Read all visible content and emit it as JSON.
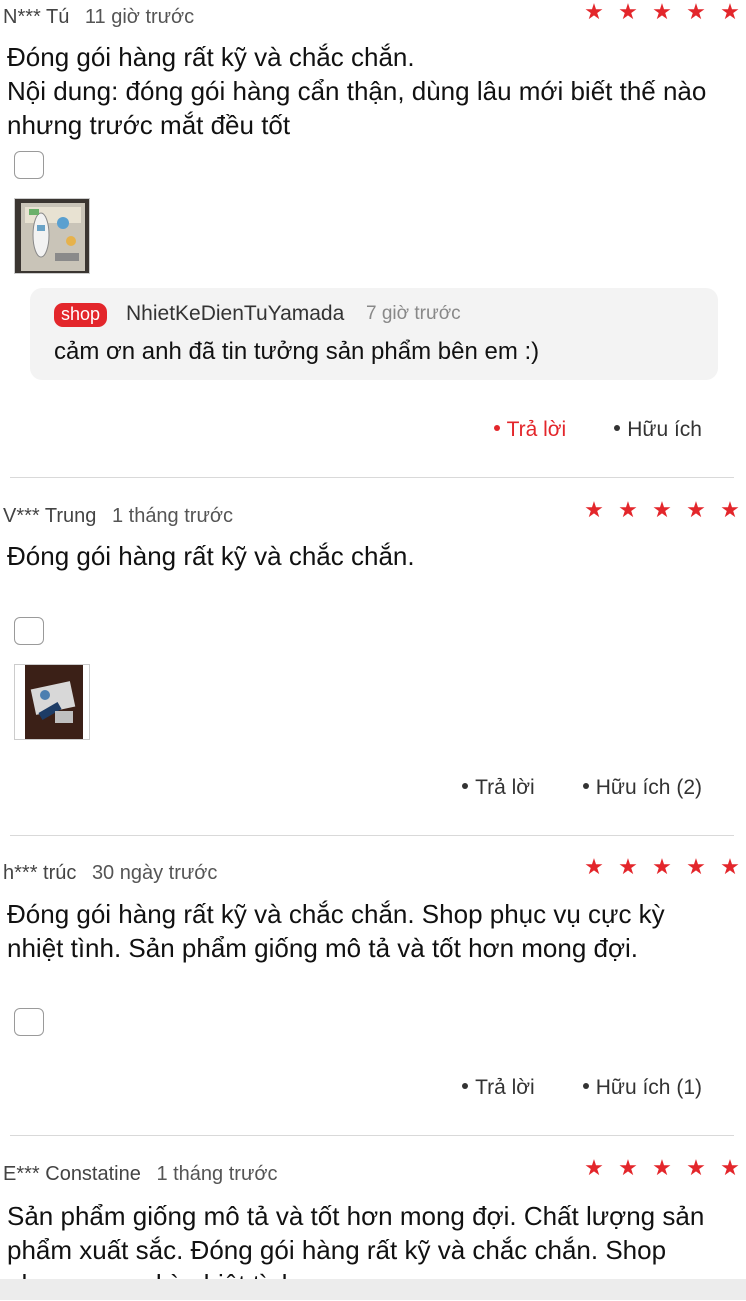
{
  "colors": {
    "accent": "#e3262b",
    "star": "#e3262b"
  },
  "reviews": [
    {
      "user": "N*** Tú",
      "time": "11 giờ trước",
      "rating": 5,
      "text_lines": [
        "Đóng gói hàng rất kỹ và chắc chắn.",
        "Nội dung: đóng gói hàng cẩn thận, dùng lâu mới biết thế nào",
        "nhưng trước mắt đều tốt"
      ],
      "shop_reply": {
        "badge": "shop",
        "name": "NhietKeDienTuYamada",
        "time": "7 giờ trước",
        "message": "cảm ơn anh đã tin tưởng sản phẩm bên em :)"
      },
      "reply_label": "Trả lời",
      "helpful_label": "Hữu ích"
    },
    {
      "user": "V*** Trung",
      "time": "1 tháng trước",
      "rating": 5,
      "text_lines": [
        "Đóng gói hàng rất kỹ và chắc chắn."
      ],
      "reply_label": "Trả lời",
      "helpful_label": "Hữu ích (2)"
    },
    {
      "user": "h*** trúc",
      "time": "30 ngày trước",
      "rating": 5,
      "text_lines": [
        "Đóng gói hàng rất kỹ và chắc chắn. Shop phục vụ cực kỳ",
        "nhiệt tình. Sản phẩm giống mô tả và tốt hơn mong đợi."
      ],
      "reply_label": "Trả lời",
      "helpful_label": "Hữu ích (1)"
    },
    {
      "user": "E*** Constatine",
      "time": "1 tháng trước",
      "rating": 5,
      "text_lines": [
        "Sản phẩm giống mô tả và tốt hơn mong đợi. Chất lượng sản",
        "phẩm xuất sắc. Đóng gói hàng rất kỹ và chắc chắn. Shop",
        "phục vụ cực kỳ nhiệt tình"
      ]
    }
  ]
}
